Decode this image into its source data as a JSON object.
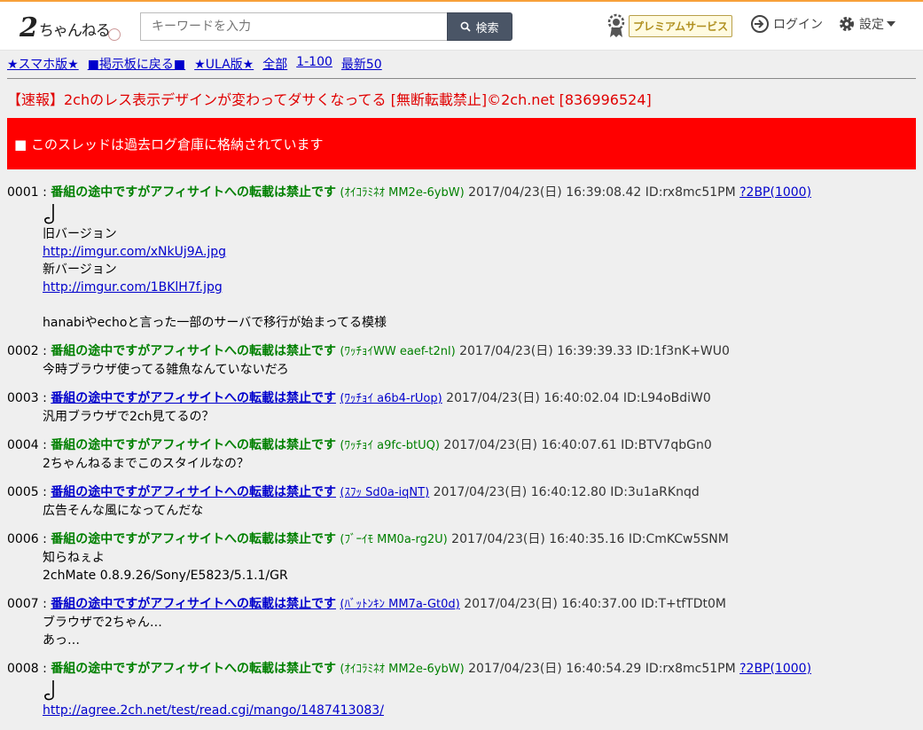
{
  "header": {
    "logo_main": "2",
    "logo_kana": "ちゃんねる",
    "search_placeholder": "キーワードを入力",
    "search_button": "検索",
    "premium_label": "プレミアムサービス",
    "login_label": "ログイン",
    "settings_label": "設定"
  },
  "nav": [
    "★スマホ版★",
    "■掲示板に戻る■",
    "★ULA版★",
    "全部",
    "1-100",
    "最新50"
  ],
  "thread_title": "【速報】2chのレス表示デザインが変わってダサくなってる [無断転載禁止]©2ch.net [836996524]",
  "banner": "■ このスレッドは過去ログ倉庫に格納されています",
  "posts": [
    {
      "num": "0001 :",
      "name": "番組の途中ですがアフィサイトへの転載は禁止です",
      "trip": "(ｵｲｺﾗﾐﾈｵ MM2e-6ybW)",
      "date": "2017/04/23(日) 16:39:08.42 ID:rx8mc51PM",
      "be": "?2BP(1000)",
      "lines": [
        "旧バージョン",
        "http://imgur.com/xNkUj9A.jpg",
        "新バージョン",
        "http://imgur.com/1BKlH7f.jpg",
        "",
        "hanabiやechoと言った一部のサーバで移行が始まってる模様"
      ]
    },
    {
      "num": "0002 :",
      "name": "番組の途中ですがアフィサイトへの転載は禁止です",
      "trip": "(ﾜｯﾁｮｲWW eaef-t2nl)",
      "date": "2017/04/23(日) 16:39:39.33 ID:1f3nK+WU0",
      "lines": [
        "今時ブラウザ使ってる雑魚なんていないだろ"
      ]
    },
    {
      "num": "0003 :",
      "name": "番組の途中ですがアフィサイトへの転載は禁止です",
      "trip": "(ﾜｯﾁｮｲ a6b4-rUop)",
      "date": "2017/04/23(日) 16:40:02.04 ID:L94oBdiW0",
      "lines": [
        "汎用ブラウザで2ch見てるの？"
      ]
    },
    {
      "num": "0004 :",
      "name": "番組の途中ですがアフィサイトへの転載は禁止です",
      "trip": "(ﾜｯﾁｮｲ a9fc-btUQ)",
      "date": "2017/04/23(日) 16:40:07.61 ID:BTV7qbGn0",
      "lines": [
        "2ちゃんねるまでこのスタイルなの？"
      ]
    },
    {
      "num": "0005 :",
      "name": "番組の途中ですがアフィサイトへの転載は禁止です",
      "trip": "(ｽﾌｯ Sd0a-iqNT)",
      "date": "2017/04/23(日) 16:40:12.80 ID:3u1aRKnqd",
      "lines": [
        "広告そんな風になってんだな"
      ]
    },
    {
      "num": "0006 :",
      "name": "番組の途中ですがアフィサイトへの転載は禁止です",
      "trip": "(ﾌﾞｰｲﾓ MM0a-rg2U)",
      "date": "2017/04/23(日) 16:40:35.16 ID:CmKCw5SNM",
      "lines": [
        "知らねぇよ",
        "2chMate 0.8.9.26/Sony/E5823/5.1.1/GR"
      ]
    },
    {
      "num": "0007 :",
      "name": "番組の途中ですがアフィサイトへの転載は禁止です",
      "trip": "(ﾊﾞｯﾄﾝｷﾝ MM7a-Gt0d)",
      "date": "2017/04/23(日) 16:40:37.00 ID:T+tfTDt0M",
      "lines": [
        "ブラウザで2ちゃん…",
        "あっ…"
      ]
    },
    {
      "num": "0008 :",
      "name": "番組の途中ですがアフィサイトへの転載は禁止です",
      "trip": "(ｵｲｺﾗﾐﾈｵ MM2e-6ybW)",
      "date": "2017/04/23(日) 16:40:54.29 ID:rx8mc51PM",
      "be": "?2BP(1000)",
      "lines": [
        "http://agree.2ch.net/test/read.cgi/mango/1487413083/"
      ]
    }
  ]
}
